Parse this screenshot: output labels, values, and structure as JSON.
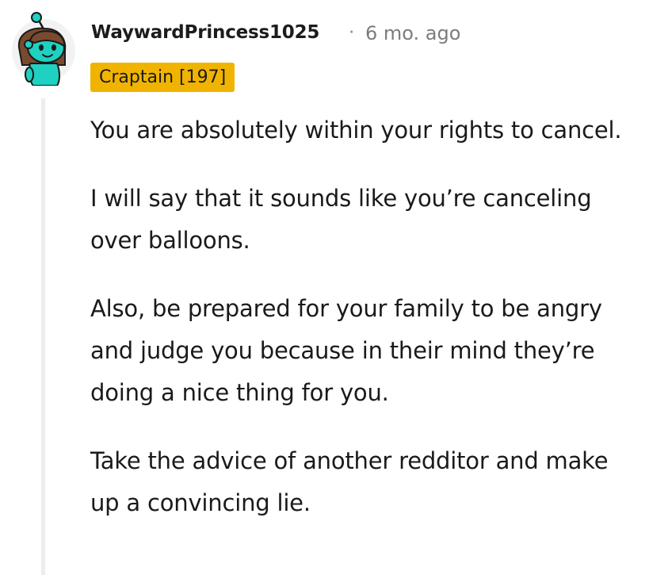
{
  "comment": {
    "author": "WaywardPrincess1025",
    "separator": "·",
    "timestamp": "6 mo. ago",
    "flair": "Craptain [197]",
    "paragraphs": [
      "You are absolutely within your rights to cancel.",
      "I will say that it sounds like you’re canceling over balloons.",
      "Also, be prepared for your family to be angry and judge you because in their mind they’re doing a nice thing for you.",
      "Take the advice of another redditor and make up a convincing lie."
    ]
  },
  "colors": {
    "flair_background": "#f0b400",
    "avatar_body": "#1fd1c1",
    "thread_line": "#ededed",
    "timestamp": "#7c7c7c"
  },
  "icons": {
    "avatar": "snoo-avatar-icon"
  }
}
